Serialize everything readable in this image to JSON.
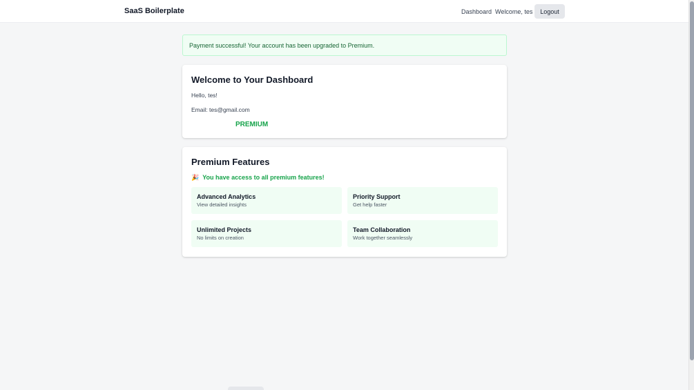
{
  "header": {
    "brand": "SaaS Boilerplate",
    "nav_dashboard": "Dashboard",
    "welcome_text": "Welcome, tes",
    "logout_label": "Logout"
  },
  "alert": {
    "message": "Payment successful! Your account has been upgraded to Premium."
  },
  "dashboard": {
    "title": "Welcome to Your Dashboard",
    "hello": "Hello, tes!",
    "email": "Email: tes@gmail.com",
    "plan": "PREMIUM"
  },
  "premium": {
    "title": "Premium Features",
    "access_icon": "party-popper-icon",
    "access_glyph": "🎉",
    "access_note": "You have access to all premium features!",
    "features": [
      {
        "title": "Advanced Analytics",
        "desc": "View detailed insights"
      },
      {
        "title": "Priority Support",
        "desc": "Get help faster"
      },
      {
        "title": "Unlimited Projects",
        "desc": "No limits on creation"
      },
      {
        "title": "Team Collaboration",
        "desc": "Work together seamlessly"
      }
    ]
  },
  "colors": {
    "accent_green": "#16a34a",
    "alert_bg": "#f0fdf4",
    "alert_text": "#166534",
    "page_bg": "#f5f6f7"
  }
}
